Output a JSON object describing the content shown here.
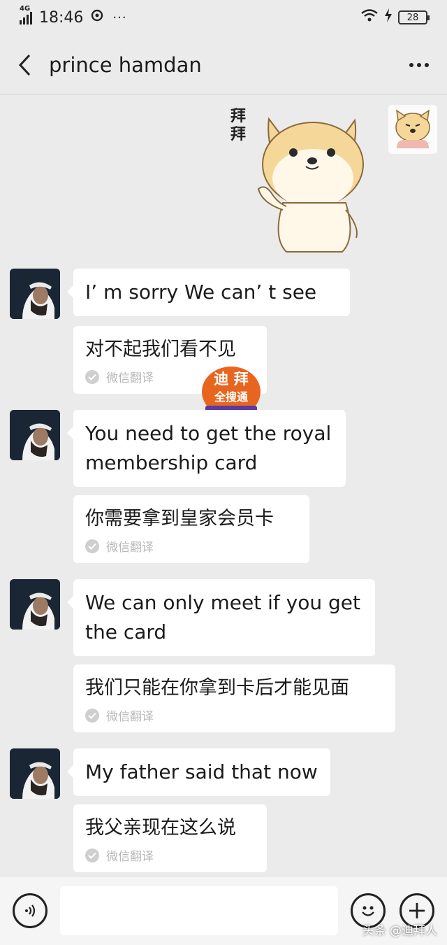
{
  "status_bar": {
    "network": "4G",
    "time": "18:46",
    "more": "···",
    "battery": "28"
  },
  "header": {
    "title": "prince hamdan"
  },
  "sticker": {
    "text_line1": "拜",
    "text_line2": "拜"
  },
  "messages": [
    {
      "text": "I’ m sorry We can’ t see",
      "translation": "对不起我们看不见",
      "translation_label": "微信翻译"
    },
    {
      "text": "You need to get the royal membership card",
      "translation": "你需要拿到皇家会员卡",
      "translation_label": "微信翻译"
    },
    {
      "text": "We can only meet if you get the card",
      "translation": "我们只能在你拿到卡后才能见面",
      "translation_label": "微信翻译"
    },
    {
      "text": "My father said that now",
      "translation": "我父亲现在这么说",
      "translation_label": "微信翻译"
    }
  ],
  "watermark": {
    "line1": "迪 拜",
    "line2": "全搜通"
  },
  "footer": {
    "source": "头条 @迪拜人"
  },
  "colors": {
    "background": "#ebebeb",
    "bubble": "#ffffff",
    "bottom_bar": "#f5f5f5"
  }
}
